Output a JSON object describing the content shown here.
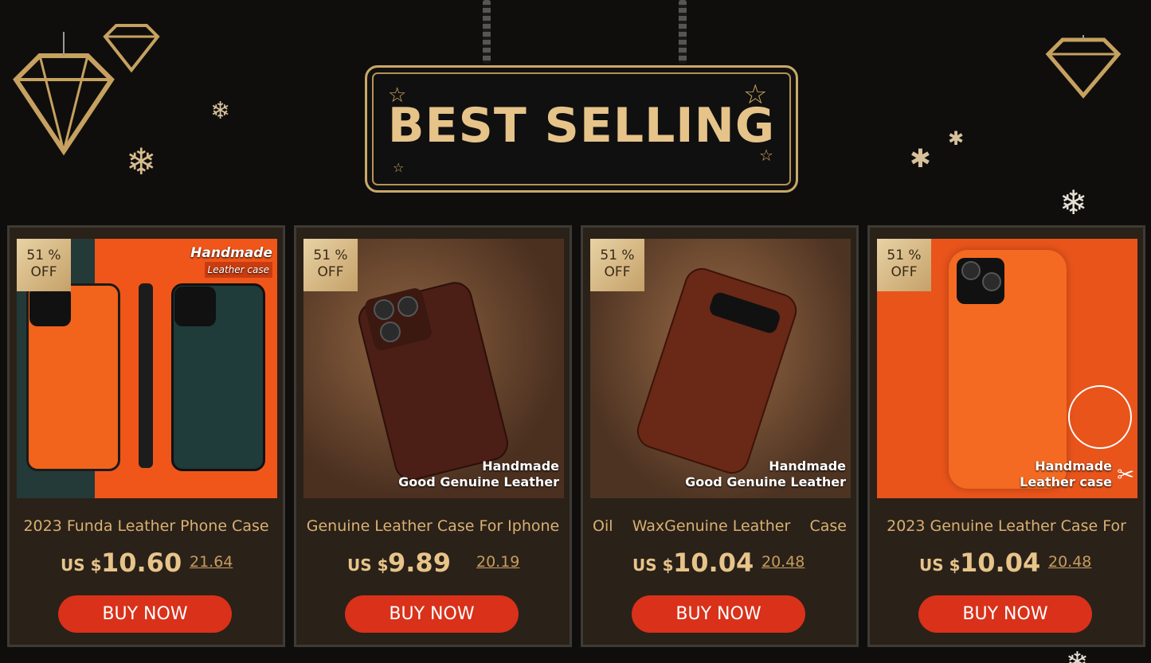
{
  "banner": {
    "title": "BEST SELLING"
  },
  "products": [
    {
      "badge_pct": "51 %",
      "badge_off": "OFF",
      "image_text_1": "Handmade",
      "image_text_2": "Leather case",
      "title": "2023 Funda Leather Phone Case",
      "currency": "US $",
      "price": "10.60",
      "old_price": "21.64",
      "button": "BUY NOW"
    },
    {
      "badge_pct": "51 %",
      "badge_off": "OFF",
      "image_text_1": "Handmade",
      "image_text_2": "Good Genuine Leather",
      "title": "Genuine Leather Case For Iphone",
      "currency": "US $",
      "price": "9.89",
      "old_price": "20.19",
      "button": "BUY NOW"
    },
    {
      "badge_pct": "51 %",
      "badge_off": "OFF",
      "image_text_1": "Handmade",
      "image_text_2": "Good Genuine Leather",
      "title": "Oil    WaxGenuine Leather    Case",
      "currency": "US $",
      "price": "10.04",
      "old_price": "20.48",
      "button": "BUY NOW"
    },
    {
      "badge_pct": "51 %",
      "badge_off": "OFF",
      "image_text_1": "Handmade",
      "image_text_2": "Leather case",
      "title": "2023 Genuine Leather Case For",
      "currency": "US $",
      "price": "10.04",
      "old_price": "20.48",
      "button": "BUY NOW"
    }
  ]
}
